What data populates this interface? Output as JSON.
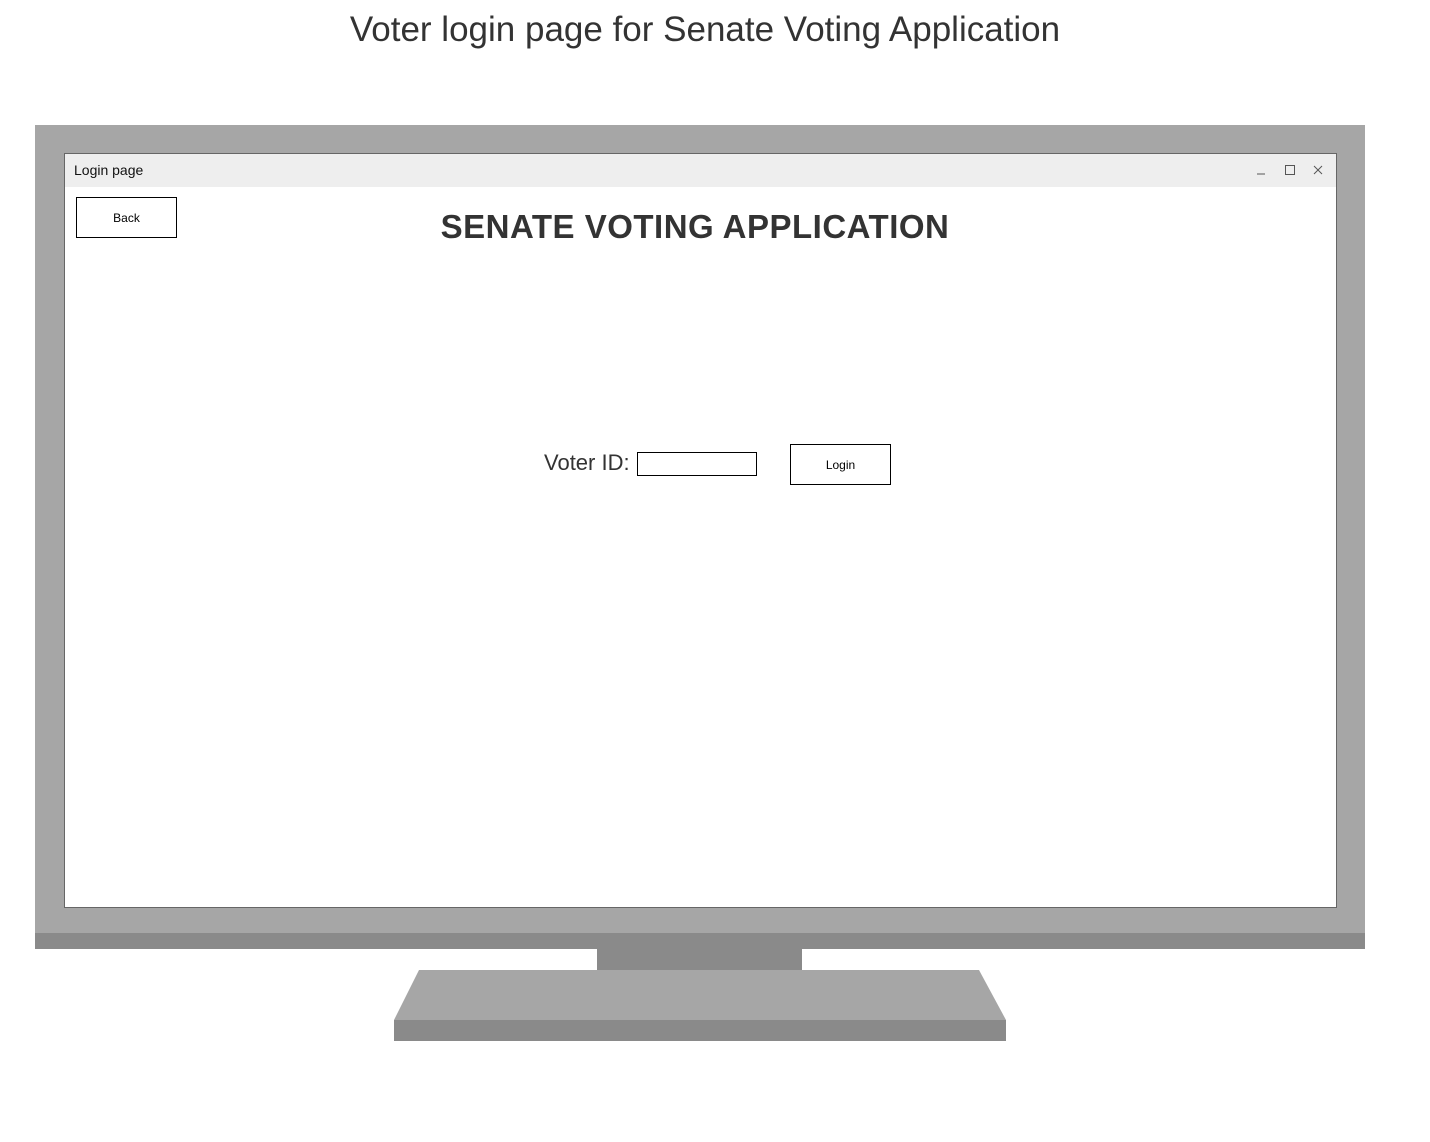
{
  "caption": "Voter login page for Senate Voting Application",
  "window": {
    "title": "Login page",
    "controls": {
      "minimize_icon": "minimize-icon",
      "maximize_icon": "maximize-icon",
      "close_icon": "close-icon"
    }
  },
  "toolbar": {
    "back_label": "Back"
  },
  "main": {
    "heading": "SENATE VOTING APPLICATION",
    "voter_id_label": "Voter ID:",
    "voter_id_value": "",
    "login_label": "Login"
  },
  "colors": {
    "bezel": "#a6a6a6",
    "bezel_dark": "#8a8a8a",
    "titlebar": "#eeeeee",
    "text": "#333333"
  }
}
